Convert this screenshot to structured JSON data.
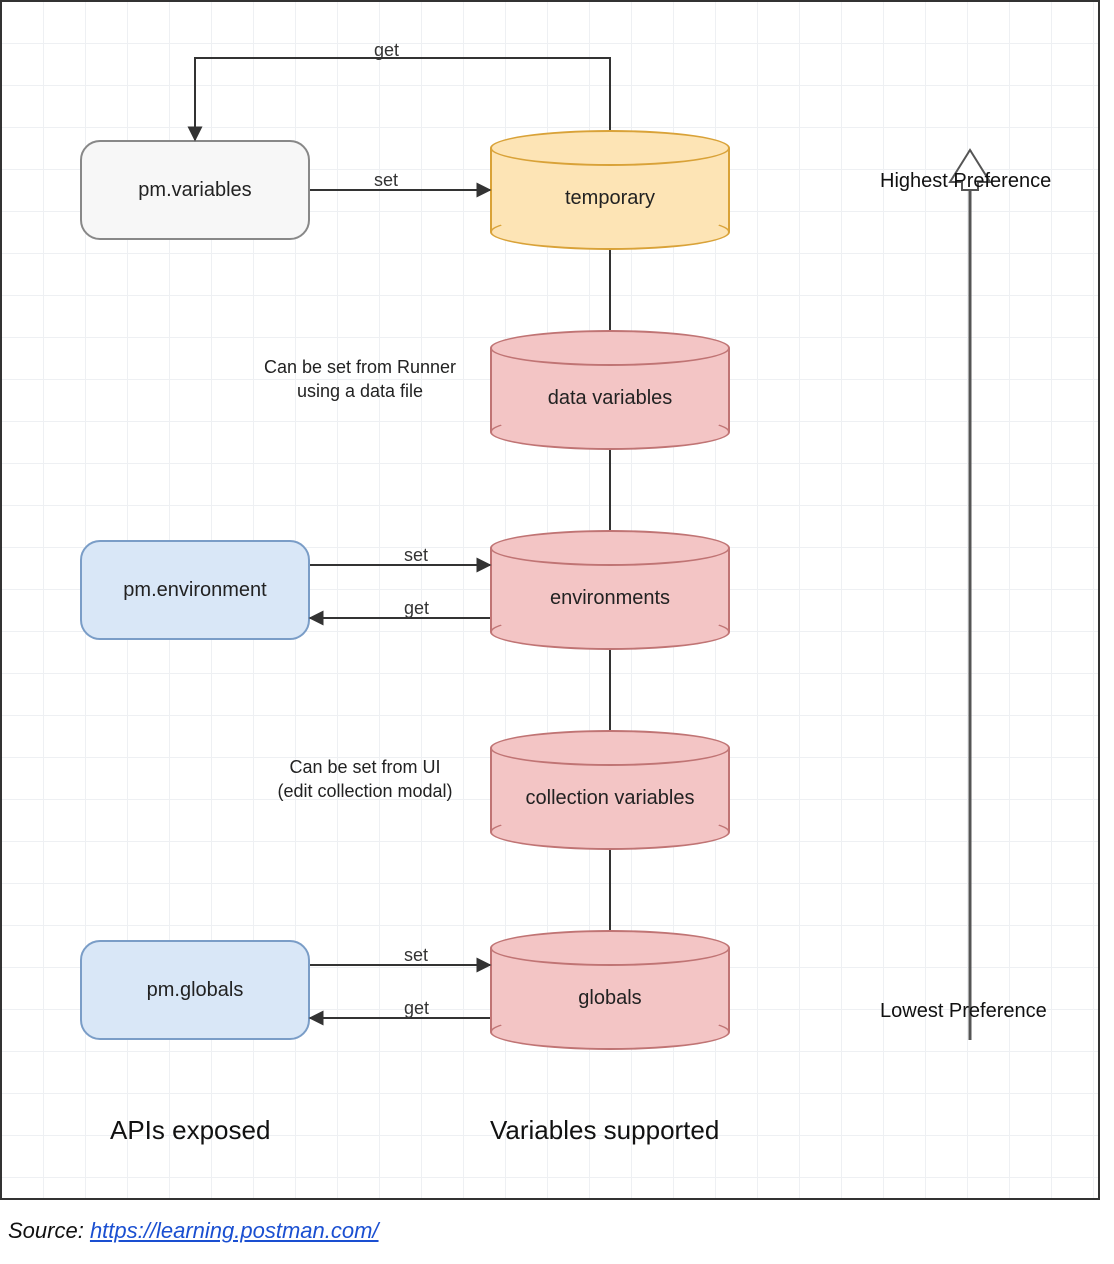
{
  "cylinders": {
    "temporary": {
      "label": "temporary"
    },
    "data": {
      "label": "data variables"
    },
    "env": {
      "label": "environments"
    },
    "collection": {
      "label": "collection variables"
    },
    "globals": {
      "label": "globals"
    }
  },
  "boxes": {
    "variables": {
      "label": "pm.variables"
    },
    "environment": {
      "label": "pm.environment"
    },
    "globals": {
      "label": "pm.globals"
    }
  },
  "edges": {
    "get": "get",
    "set": "set"
  },
  "notes": {
    "data": "Can be set from Runner\nusing a data file",
    "collection": "Can be set from UI\n(edit collection modal)"
  },
  "columns": {
    "apis": "APIs exposed",
    "vars": "Variables supported"
  },
  "preference": {
    "high": "Highest Preference",
    "low": "Lowest Preference"
  },
  "source": {
    "prefix": "Source: ",
    "text": "https://learning.postman.com/",
    "href": "https://learning.postman.com/"
  }
}
